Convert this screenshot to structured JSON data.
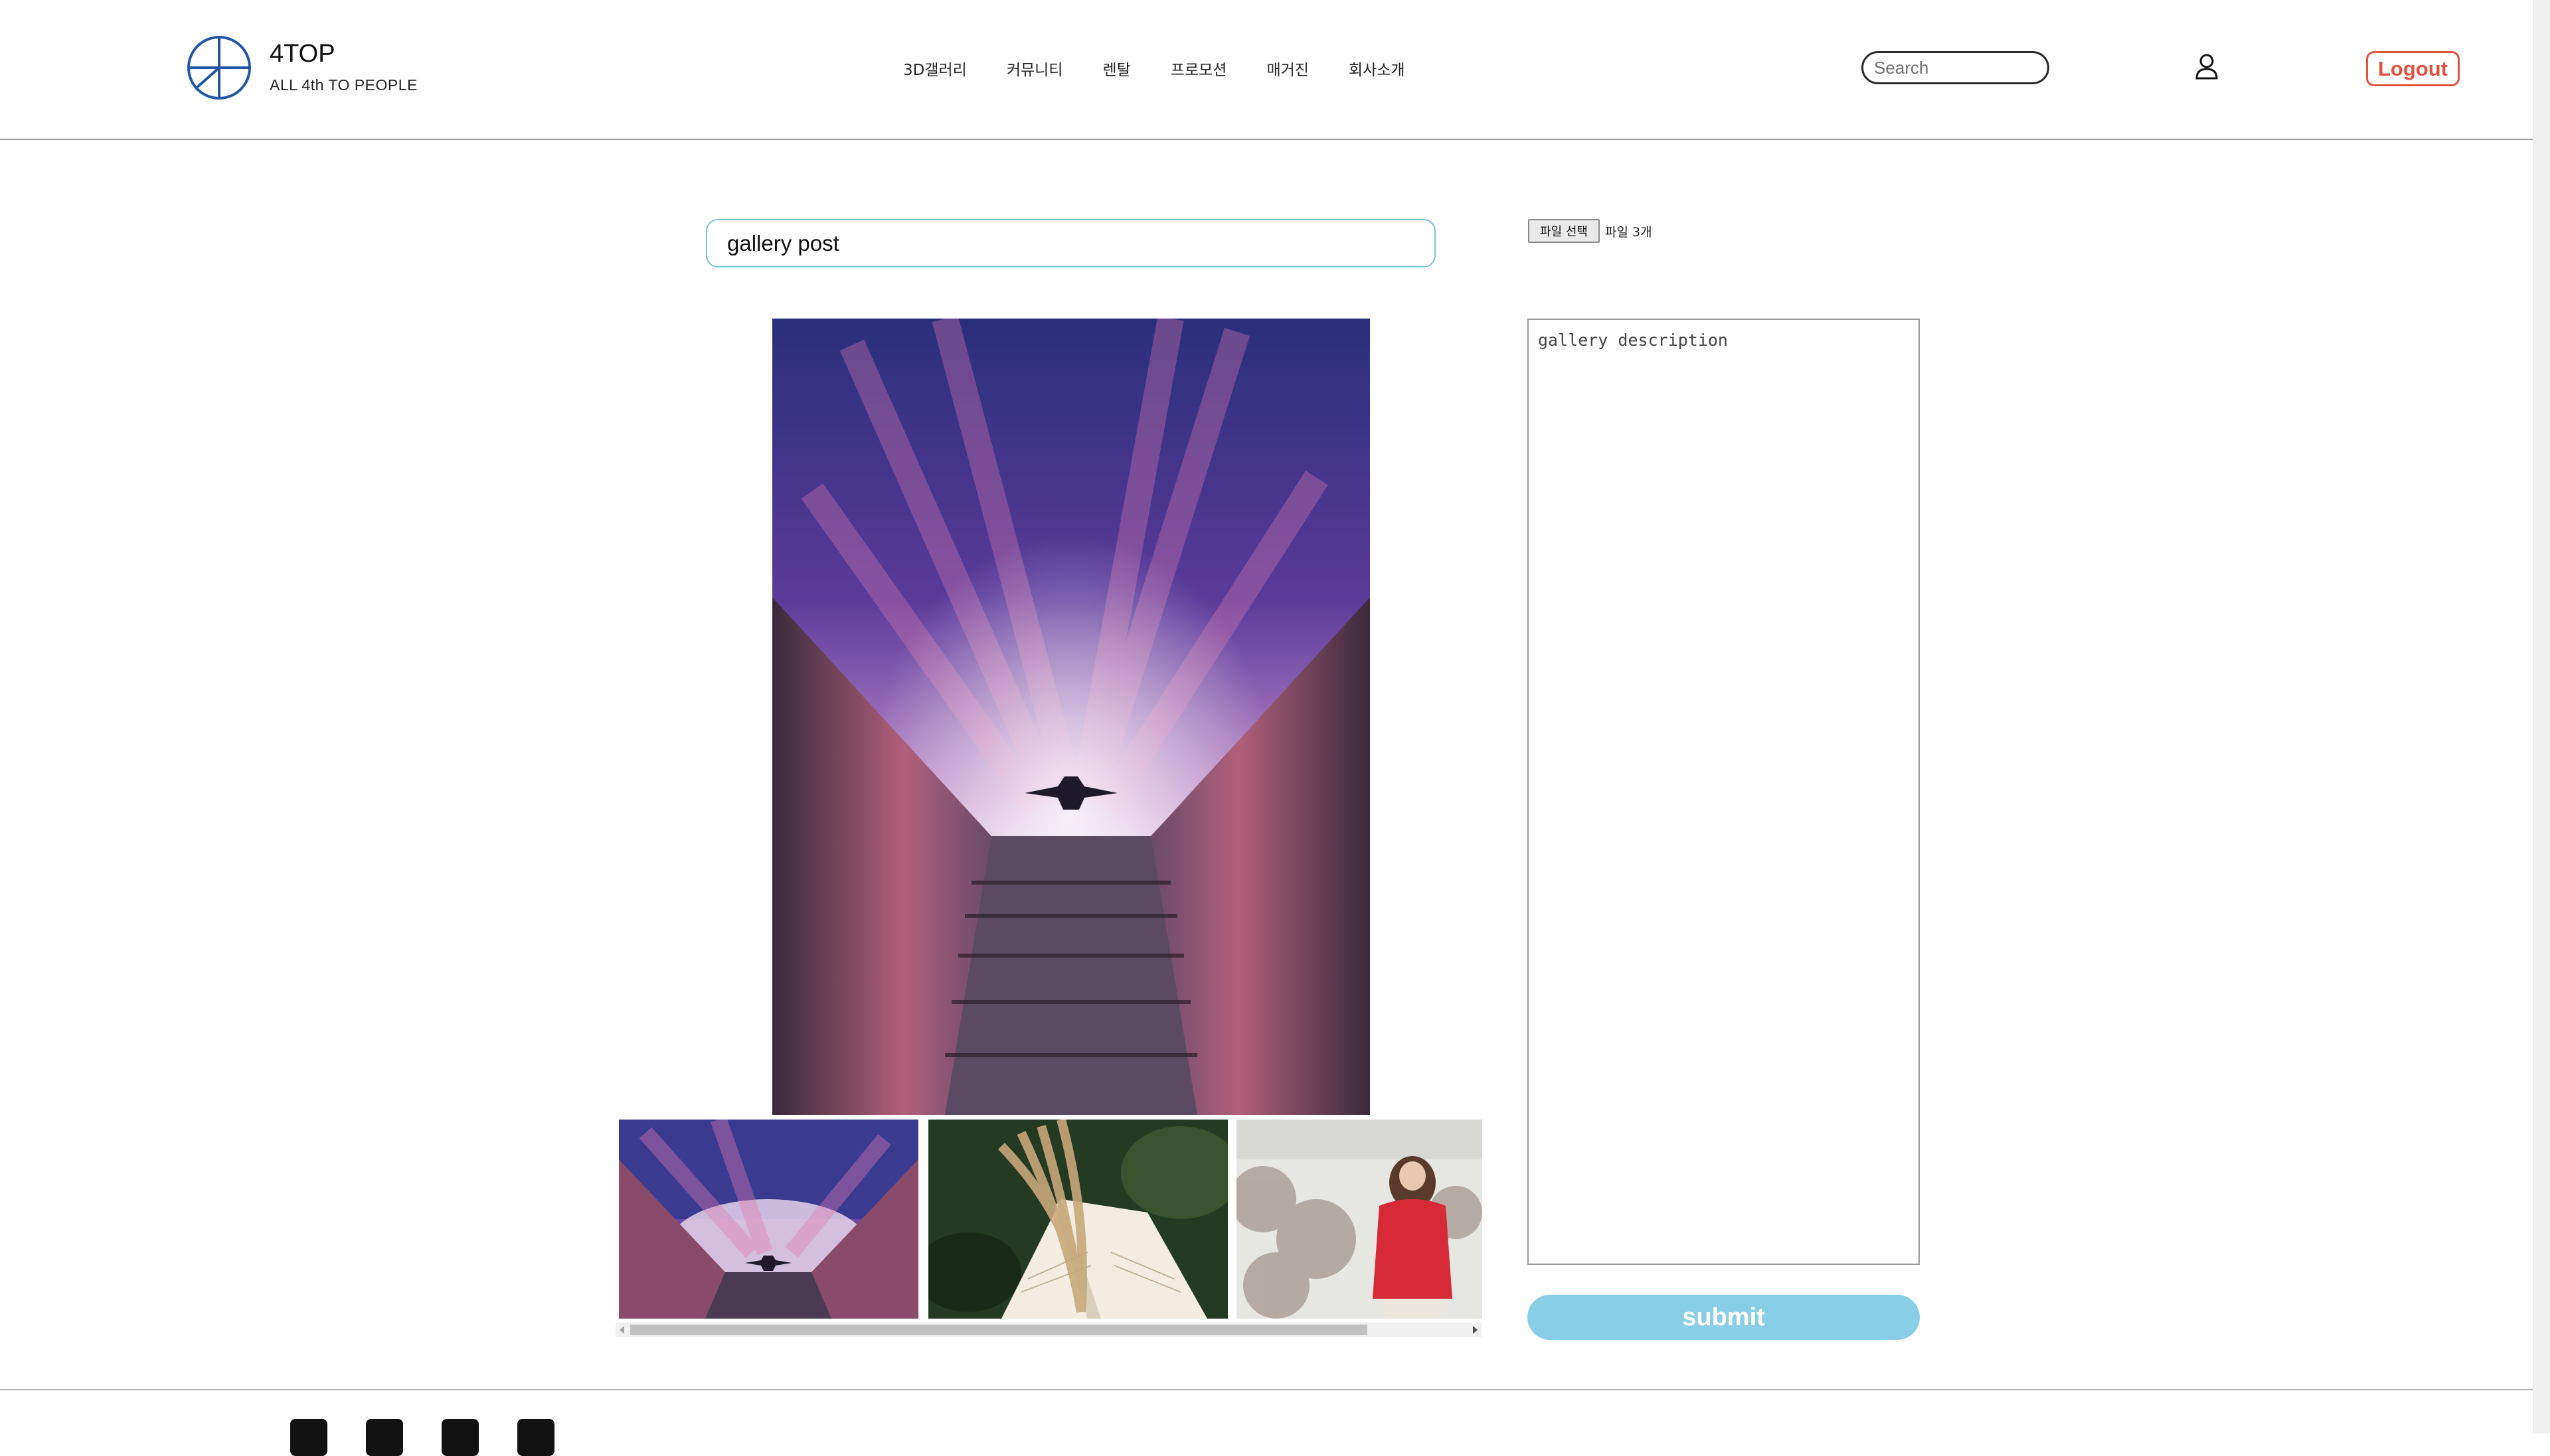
{
  "header": {
    "brand": "4TOP",
    "tagline": "ALL 4th TO PEOPLE",
    "nav": [
      "3D갤러리",
      "커뮤니티",
      "렌탈",
      "프로모션",
      "매거진",
      "회사소개"
    ],
    "search_placeholder": "Search",
    "logout_label": "Logout",
    "user_icon": "user-icon"
  },
  "form": {
    "title_value": "gallery post",
    "file_button_label": "파일 선택",
    "file_count": "파일 3개",
    "description_value": "gallery description",
    "submit_label": "submit"
  },
  "gallery": {
    "main_image": "night sky with milky way between buildings and airplane",
    "thumbnails": [
      "sky-buildings-airplane",
      "dried-grass-on-open-book",
      "woman-in-red-sweater-snow"
    ]
  },
  "footer": {
    "social_icons": [
      "facebook-icon",
      "instagram-icon",
      "twitter-icon",
      "youtube-icon"
    ]
  },
  "colors": {
    "accent": "#e2533f",
    "submit_bg": "#8acde6",
    "input_border": "#7ec4d4",
    "logo_blue": "#2455a4"
  }
}
